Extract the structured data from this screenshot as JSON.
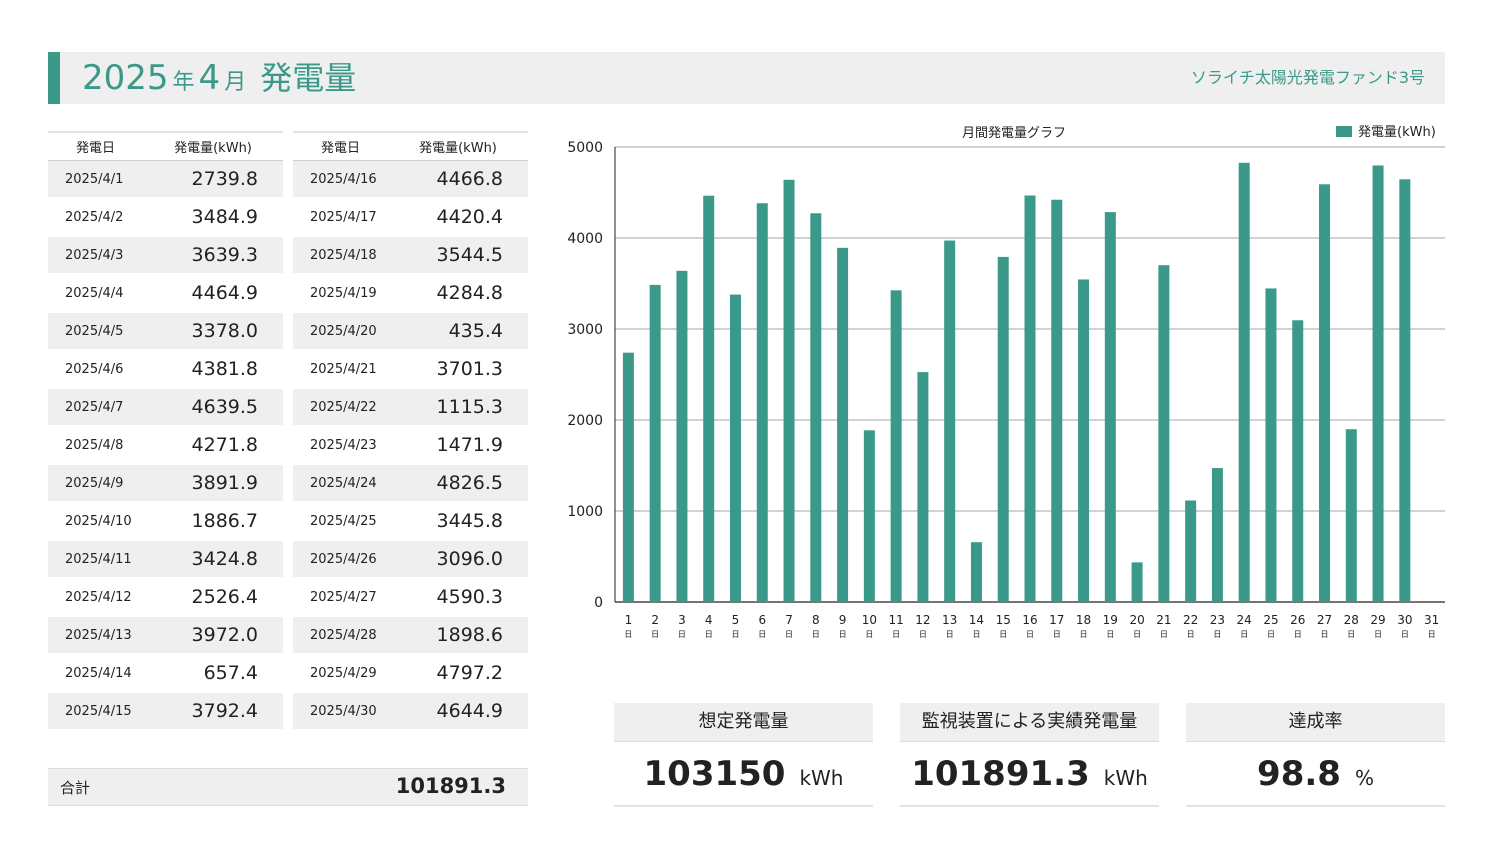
{
  "header": {
    "year": "2025",
    "year_unit": "年",
    "month": "4",
    "month_unit": "月",
    "title": "発電量",
    "fund_name": "ソライチ太陽光発電ファンド3号"
  },
  "colors": {
    "accent": "#3b998a",
    "row_bg": "#efefef"
  },
  "table": {
    "col_date": "発電日",
    "col_value": "発電量(kWh)",
    "left": [
      {
        "date": "2025/4/1",
        "value": "2739.8"
      },
      {
        "date": "2025/4/2",
        "value": "3484.9"
      },
      {
        "date": "2025/4/3",
        "value": "3639.3"
      },
      {
        "date": "2025/4/4",
        "value": "4464.9"
      },
      {
        "date": "2025/4/5",
        "value": "3378.0"
      },
      {
        "date": "2025/4/6",
        "value": "4381.8"
      },
      {
        "date": "2025/4/7",
        "value": "4639.5"
      },
      {
        "date": "2025/4/8",
        "value": "4271.8"
      },
      {
        "date": "2025/4/9",
        "value": "3891.9"
      },
      {
        "date": "2025/4/10",
        "value": "1886.7"
      },
      {
        "date": "2025/4/11",
        "value": "3424.8"
      },
      {
        "date": "2025/4/12",
        "value": "2526.4"
      },
      {
        "date": "2025/4/13",
        "value": "3972.0"
      },
      {
        "date": "2025/4/14",
        "value": "657.4"
      },
      {
        "date": "2025/4/15",
        "value": "3792.4"
      }
    ],
    "right": [
      {
        "date": "2025/4/16",
        "value": "4466.8"
      },
      {
        "date": "2025/4/17",
        "value": "4420.4"
      },
      {
        "date": "2025/4/18",
        "value": "3544.5"
      },
      {
        "date": "2025/4/19",
        "value": "4284.8"
      },
      {
        "date": "2025/4/20",
        "value": "435.4"
      },
      {
        "date": "2025/4/21",
        "value": "3701.3"
      },
      {
        "date": "2025/4/22",
        "value": "1115.3"
      },
      {
        "date": "2025/4/23",
        "value": "1471.9"
      },
      {
        "date": "2025/4/24",
        "value": "4826.5"
      },
      {
        "date": "2025/4/25",
        "value": "3445.8"
      },
      {
        "date": "2025/4/26",
        "value": "3096.0"
      },
      {
        "date": "2025/4/27",
        "value": "4590.3"
      },
      {
        "date": "2025/4/28",
        "value": "1898.6"
      },
      {
        "date": "2025/4/29",
        "value": "4797.2"
      },
      {
        "date": "2025/4/30",
        "value": "4644.9"
      }
    ],
    "total_label": "合計",
    "total_value": "101891.3"
  },
  "chart_data": {
    "type": "bar",
    "title": "月間発電量グラフ",
    "xlabel": "",
    "ylabel": "",
    "ylim": [
      0,
      5000
    ],
    "yticks": [
      0,
      1000,
      2000,
      3000,
      4000,
      5000
    ],
    "grid": true,
    "legend_position": "top-right",
    "color": "#3b998a",
    "categories": [
      "1",
      "2",
      "3",
      "4",
      "5",
      "6",
      "7",
      "8",
      "9",
      "10",
      "11",
      "12",
      "13",
      "14",
      "15",
      "16",
      "17",
      "18",
      "19",
      "20",
      "21",
      "22",
      "23",
      "24",
      "25",
      "26",
      "27",
      "28",
      "29",
      "30",
      "31"
    ],
    "category_suffix": "日",
    "series": [
      {
        "name": "発電量(kWh)",
        "values": [
          2739.8,
          3484.9,
          3639.3,
          4464.9,
          3378.0,
          4381.8,
          4639.5,
          4271.8,
          3891.9,
          1886.7,
          3424.8,
          2526.4,
          3972.0,
          657.4,
          3792.4,
          4466.8,
          4420.4,
          3544.5,
          4284.8,
          435.4,
          3701.3,
          1115.3,
          1471.9,
          4826.5,
          3445.8,
          3096.0,
          4590.3,
          1898.6,
          4797.2,
          4644.9,
          null
        ]
      }
    ]
  },
  "summary": [
    {
      "label": "想定発電量",
      "value": "103150",
      "unit": "kWh"
    },
    {
      "label": "監視装置による実績発電量",
      "value": "101891.3",
      "unit": "kWh"
    },
    {
      "label": "達成率",
      "value": "98.8",
      "unit": "%"
    }
  ]
}
